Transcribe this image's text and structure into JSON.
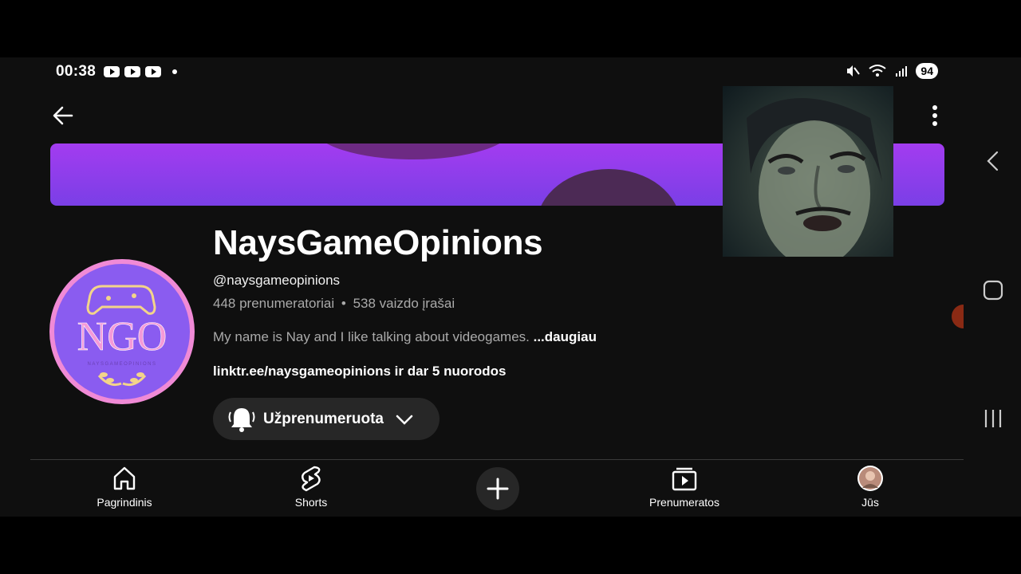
{
  "status_bar": {
    "time": "00:38",
    "notification_icons": [
      "youtube-icon",
      "youtube-icon",
      "youtube-icon"
    ],
    "battery": "94"
  },
  "channel": {
    "name": "NaysGameOpinions",
    "handle": "@naysgameopinions",
    "subscribers": "448 prenumeratoriai",
    "separator": "•",
    "videos": "538 vaizdo įrašai",
    "description": "My name is Nay and I like talking about videogames.",
    "more_label": "...daugiau",
    "links": "linktr.ee/naysgameopinions ir dar 5 nuorodos",
    "avatar_text": "NGO",
    "avatar_caption": "NAYSGAMEOPINIONS"
  },
  "subscribe_button": {
    "label": "Užprenumeruota"
  },
  "bottom_nav": {
    "home": "Pagrindinis",
    "shorts": "Shorts",
    "subscriptions": "Prenumeratos",
    "you": "Jūs"
  },
  "colors": {
    "background": "#0f0f0f",
    "banner": "#8a3fe8",
    "avatar_ring": "#f08ad6",
    "avatar_fill": "#8a5cf0",
    "button_bg": "#272727",
    "secondary_text": "#aaaaaa"
  }
}
